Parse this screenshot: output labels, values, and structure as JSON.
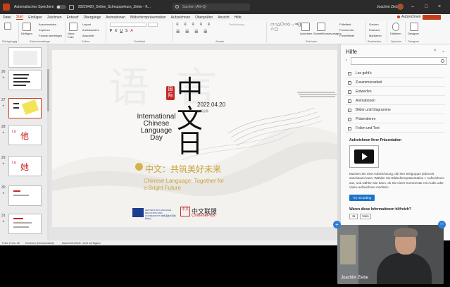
{
  "titlebar": {
    "autosave_label": "Automatisches Speichern",
    "filename": "20220420_Online_Schnupperkurs_Ziebe  -  K...",
    "search_placeholder": "Suchen (Alt+Q)",
    "user_name": "Joachim Ziebe"
  },
  "ribbon_tabs": [
    "Datei",
    "Start",
    "Einfügen",
    "Zeichnen",
    "Entwurf",
    "Übergänge",
    "Animationen",
    "Bildschirmpräsentation",
    "Aufzeichnen",
    "Überprüfen",
    "Ansicht",
    "Hilfe"
  ],
  "active_tab": "Start",
  "record_label": "Aufzeichnen",
  "share_label": "",
  "ribbon": {
    "clipboard": {
      "label": "Zwischenablage",
      "paste": "Einfügen",
      "cut": "Ausschneiden",
      "copy": "Kopieren",
      "format": "Format übertragen",
      "undo_label": "Rückgängig"
    },
    "slides": {
      "label": "Folien",
      "new": "Neue Folie",
      "layout": "Layout",
      "reset": "Zurücksetzen",
      "section": "Abschnitt"
    },
    "font": {
      "label": "Schriftart"
    },
    "paragraph": {
      "label": "Absatz"
    },
    "mixed": {
      "label": "Textrichtung"
    },
    "drawing": {
      "label": "Zeichnen",
      "arrange": "Anordnen",
      "quick": "Schnellformatvorlagen",
      "fill": "Fülleffekt",
      "outline": "Formkontur",
      "effects": "Formeffekte"
    },
    "editing": {
      "label": "Bearbeiten",
      "find": "Suchen",
      "replace": "Ersetzen",
      "select": "Markieren"
    },
    "voice": {
      "label": "Sprache",
      "dictate": "Diktieren"
    },
    "designer": {
      "label": "Designer",
      "designer_btn": "Designer"
    }
  },
  "slides": [
    {
      "num": "26"
    },
    {
      "num": "27"
    },
    {
      "num": "28"
    },
    {
      "num": "29"
    },
    {
      "num": "30"
    },
    {
      "num": "31"
    }
  ],
  "slide": {
    "seal": "国际",
    "title_chars": [
      "中",
      "文",
      "日"
    ],
    "date": "2022.04.20",
    "date_sub": "农历谷雨",
    "intl": "International Chinese Language Day",
    "slogan_cn": "中文：共筑美好未来",
    "slogan_en": "Chinese Language: Together for a Bright Future",
    "logo1_text": "CENTER FOR LANGUAGE EDUCATION AND COOPERATION 中外语言交流合作中心",
    "logo2_mark": "中文",
    "logo2_cn": "中文联盟",
    "logo2_en": "ChinesePlus"
  },
  "help": {
    "title": "Hilfe",
    "items": [
      "Los geht's",
      "Zusammenarbeit",
      "Entwerfen",
      "Animationen",
      "Bilder und Diagramme",
      "Präsentieren",
      "Folien und Text"
    ],
    "section_title": "Aufzeichnen Ihrer Präsentation",
    "paragraph": "Machen Sie eine Aufzeichnung, die Ihre Zielgruppe jederzeit anschauen kann. Wählen Sie Bildschirmpräsentation > Aufzeichnen aus, und wählen Sie dann, ob Sie einen Kommentar mit Audio oder Video aufzeichnen möchten.",
    "button": "Try recording",
    "question": "Waren diese Informationen hilfreich?",
    "yes": "Ja",
    "no": "Nein"
  },
  "status": {
    "slide": "Folie 2 von 32",
    "language": "Deutsch (Deutschland)",
    "accessibility": "Barrierefreiheit: nicht verfügbar"
  },
  "webcam": {
    "name": "Joachim Ziebe"
  },
  "colors": {
    "accent": "#c43e1c",
    "help_button": "#1a73c9",
    "slogan": "#c9a33a",
    "seal": "#c62828"
  }
}
